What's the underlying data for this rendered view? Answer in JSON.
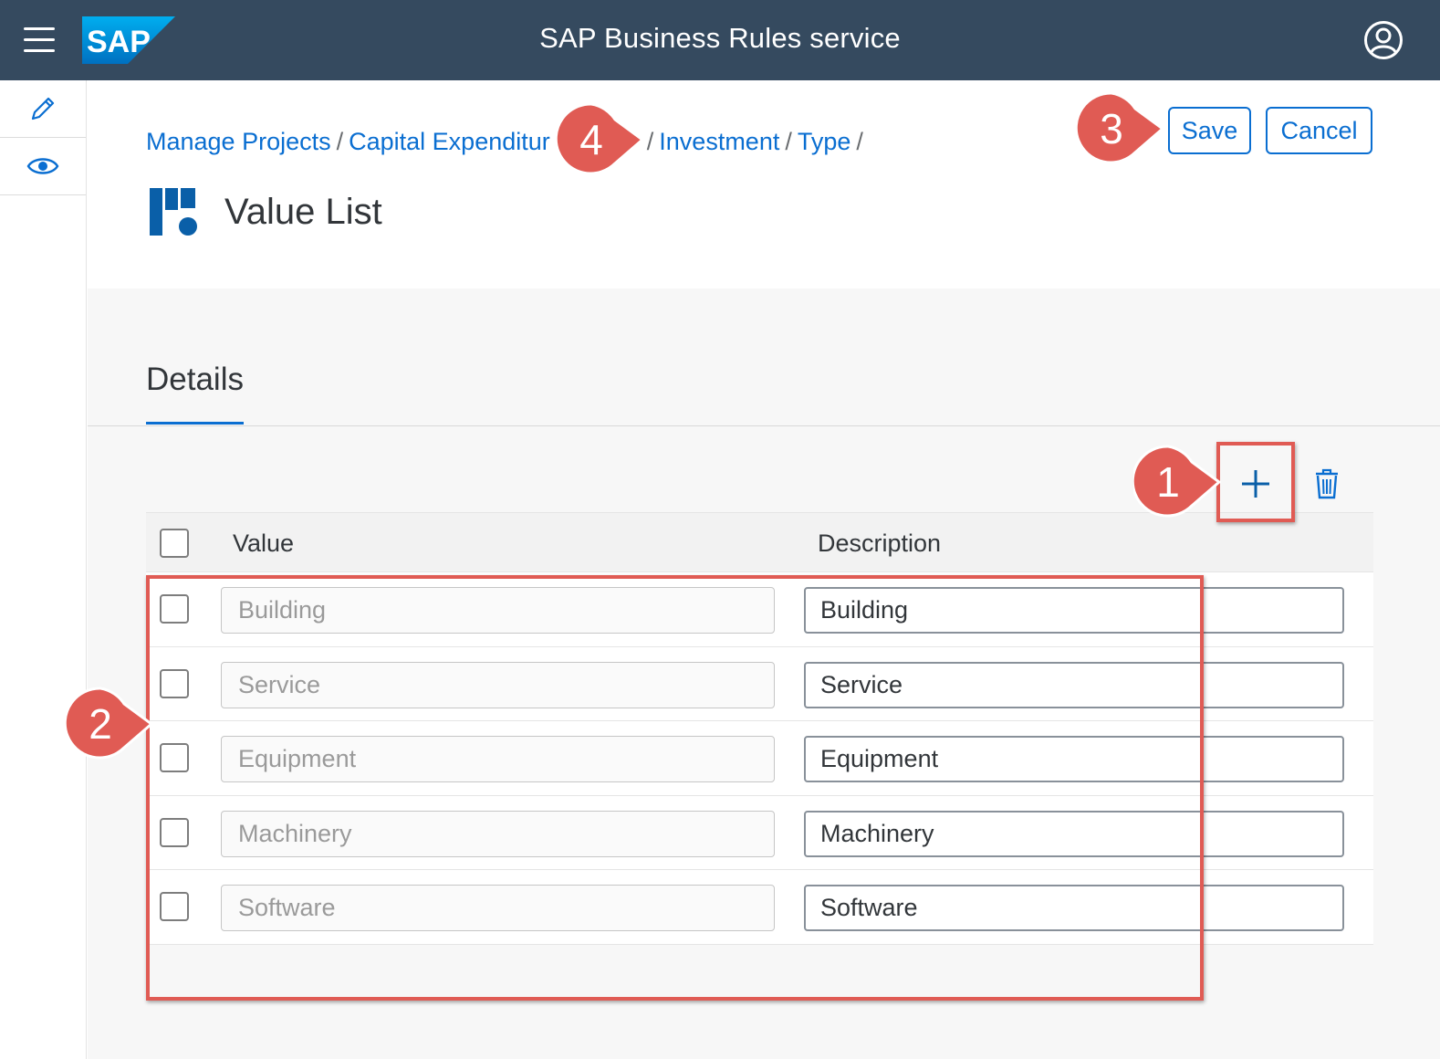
{
  "shell": {
    "title": "SAP Business Rules service",
    "logo_text": "SAP"
  },
  "breadcrumb": {
    "items": [
      "Manage Projects",
      "Capital Expenditur",
      "Investment",
      "Type"
    ],
    "separator": "/"
  },
  "page": {
    "title": "Value List",
    "save_label": "Save",
    "cancel_label": "Cancel"
  },
  "tabs": {
    "details": "Details"
  },
  "table": {
    "columns": [
      "Value",
      "Description"
    ],
    "rows": [
      {
        "value_placeholder": "Building",
        "description": "Building"
      },
      {
        "value_placeholder": "Service",
        "description": "Service"
      },
      {
        "value_placeholder": "Equipment",
        "description": "Equipment"
      },
      {
        "value_placeholder": "Machinery",
        "description": "Machinery"
      },
      {
        "value_placeholder": "Software",
        "description": "Software"
      }
    ]
  },
  "annotations": {
    "step1": "1",
    "step2": "2",
    "step3": "3",
    "step4": "4"
  },
  "colors": {
    "shell_bg": "#354a5f",
    "accent": "#0a6ed1",
    "callout": "#e05b54"
  },
  "icons": {
    "menu": "hamburger-icon",
    "user": "user-account-icon",
    "edit": "pencil-icon",
    "display": "eye-icon",
    "object": "value-list-icon",
    "add": "plus-icon",
    "delete": "trash-icon"
  }
}
